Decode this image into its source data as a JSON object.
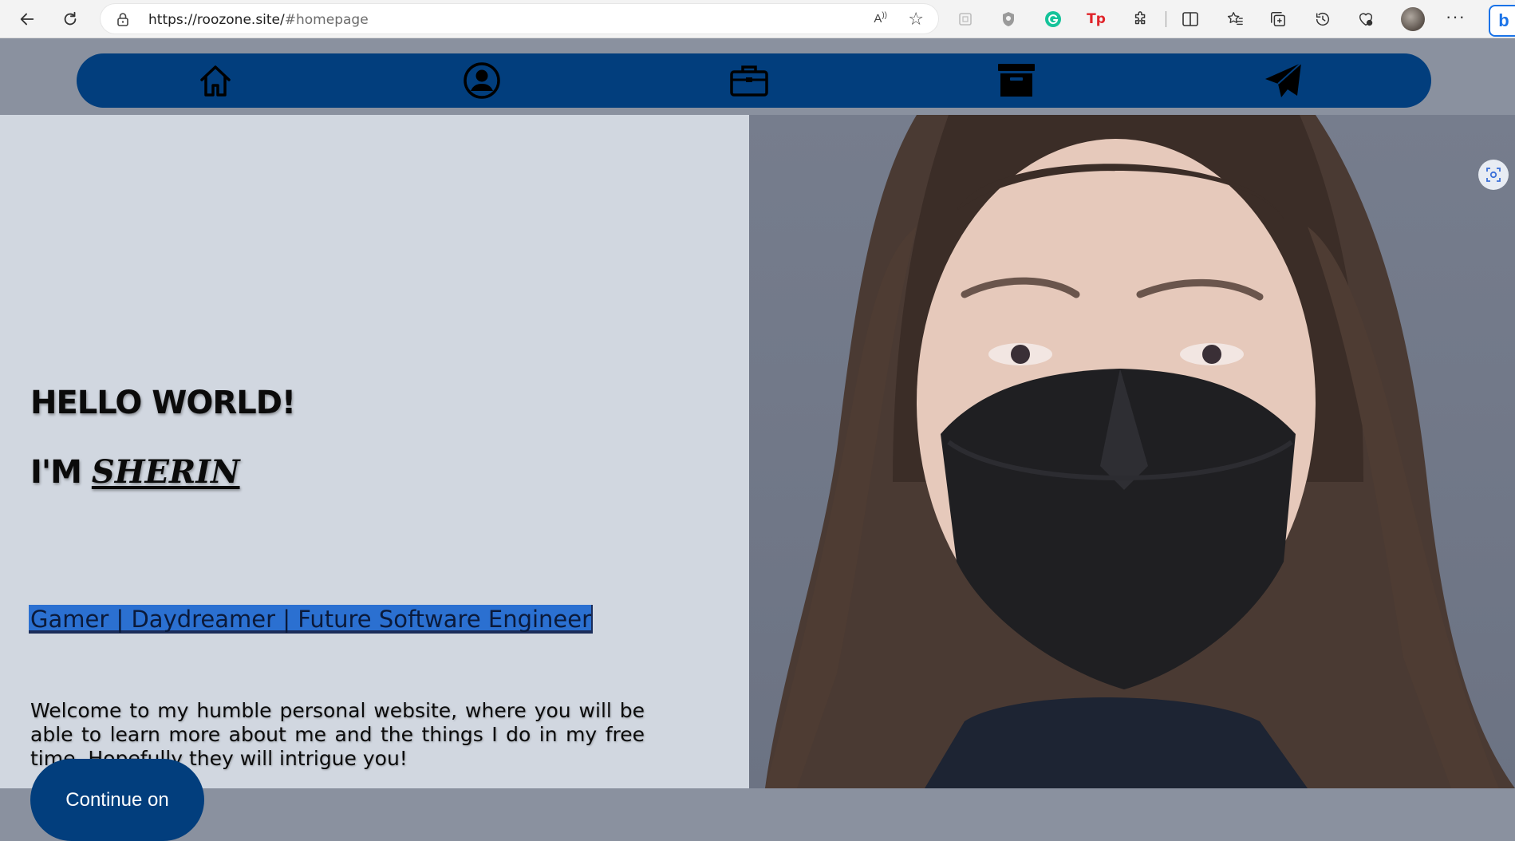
{
  "browser": {
    "url_host": "https://roozone.site/",
    "url_path": "#homepage",
    "read_aloud_label": "A̸͡",
    "more_label": "···",
    "bing_label": "b"
  },
  "nav": {
    "items": [
      {
        "icon": "home-icon"
      },
      {
        "icon": "user-circle-icon"
      },
      {
        "icon": "briefcase-icon"
      },
      {
        "icon": "archive-icon"
      },
      {
        "icon": "paper-plane-icon"
      }
    ]
  },
  "hero": {
    "greeting": "HELLO WORLD!",
    "intro_prefix": "I'M ",
    "name": "SHERIN",
    "tagline": "Gamer | Daydreamer | Future Software Engineer",
    "welcome": "Welcome to my humble personal website, where you will be able to learn more about me and the things I do in my free time. Hopefully they will intrigue you!",
    "cta_label": "Continue on"
  },
  "colors": {
    "nav_bg": "#023e7d",
    "left_panel_bg": "#d1d7e0",
    "page_bg": "#8a919f",
    "tagline_highlight": "#2b70d1"
  }
}
